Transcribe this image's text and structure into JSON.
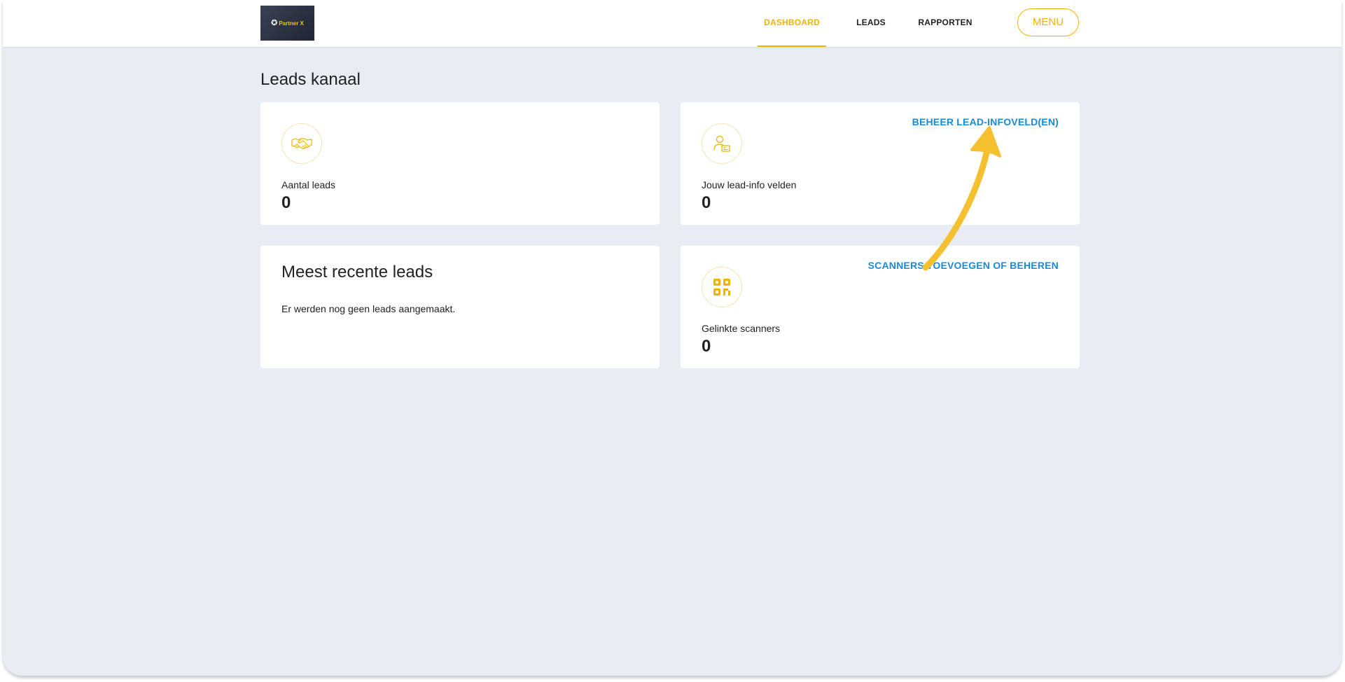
{
  "app": {
    "logo_text": "Partner X",
    "logo_glyph": "✪"
  },
  "nav": {
    "items": [
      {
        "label": "DASHBOARD",
        "active": true
      },
      {
        "label": "LEADS",
        "active": false
      },
      {
        "label": "RAPPORTEN",
        "active": false
      }
    ],
    "menu_label": "MENU"
  },
  "page": {
    "title": "Leads kanaal"
  },
  "cards": {
    "leads": {
      "icon": "handshake-icon",
      "label": "Aantal leads",
      "value": "0"
    },
    "fields": {
      "icon": "user-card-icon",
      "label": "Jouw lead-info velden",
      "value": "0",
      "link": "BEHEER LEAD-INFOVELD(EN)"
    },
    "recent": {
      "heading": "Meest recente leads",
      "text": "Er werden nog geen leads aangemaakt."
    },
    "scanners": {
      "icon": "qr-code-icon",
      "label": "Gelinkte scanners",
      "value": "0",
      "link": "SCANNERS TOEVOEGEN OF BEHEREN"
    }
  },
  "colors": {
    "accent": "#f0b400",
    "link": "#1a8ad6",
    "background": "#e8edf4",
    "arrow": "#f5c030"
  }
}
